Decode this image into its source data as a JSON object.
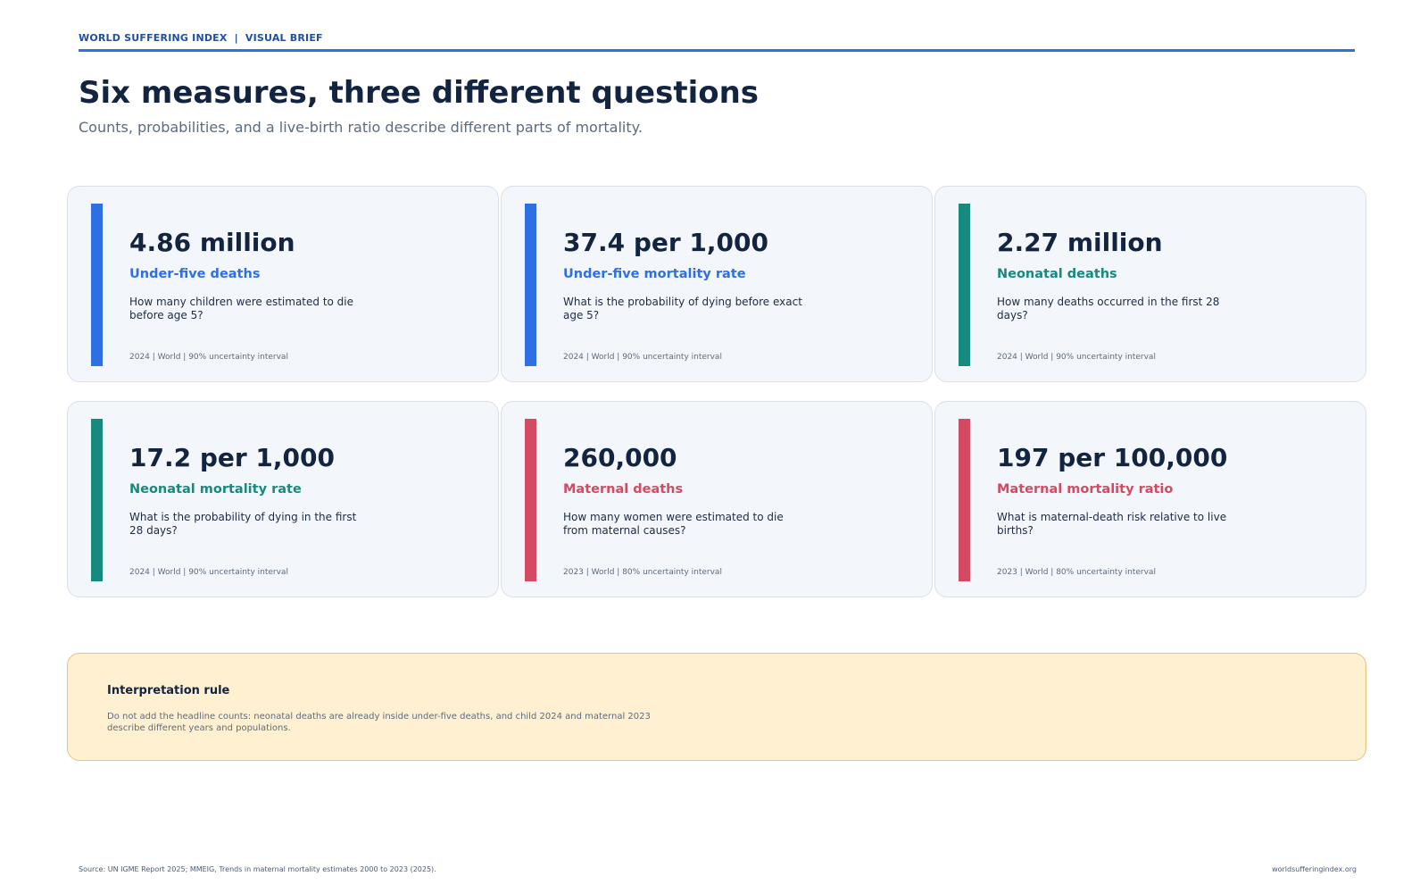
{
  "header": {
    "kicker": "WORLD SUFFERING INDEX  |  VISUAL BRIEF",
    "title": "Six measures, three different questions",
    "subtitle": "Counts, probabilities, and a live-birth ratio describe different parts of mortality."
  },
  "colors": {
    "accent_blue": "#2f6fe4",
    "teal": "#178a80",
    "red": "#d44a63",
    "note_bg": "#fef0d0",
    "note_border": "#e7c374"
  },
  "cards": [
    {
      "value": "4.86 million",
      "label": "Under-five deaths",
      "question": "How many children were estimated to die before age 5?",
      "meta": "2024 | World | 90% uncertainty interval",
      "color": "#2f6fe4"
    },
    {
      "value": "37.4 per 1,000",
      "label": "Under-five mortality rate",
      "question": "What is the probability of dying before exact age 5?",
      "meta": "2024 | World | 90% uncertainty interval",
      "color": "#2f6fe4"
    },
    {
      "value": "2.27 million",
      "label": "Neonatal deaths",
      "question": "How many deaths occurred in the first 28 days?",
      "meta": "2024 | World | 90% uncertainty interval",
      "color": "#178a80"
    },
    {
      "value": "17.2 per 1,000",
      "label": "Neonatal mortality rate",
      "question": "What is the probability of dying in the first 28 days?",
      "meta": "2024 | World | 90% uncertainty interval",
      "color": "#178a80"
    },
    {
      "value": "260,000",
      "label": "Maternal deaths",
      "question": "How many women were estimated to die from maternal causes?",
      "meta": "2023 | World | 80% uncertainty interval",
      "color": "#d44a63"
    },
    {
      "value": "197 per 100,000",
      "label": "Maternal mortality ratio",
      "question": "What is maternal-death risk relative to live births?",
      "meta": "2023 | World | 80% uncertainty interval",
      "color": "#d44a63"
    }
  ],
  "note": {
    "title": "Interpretation rule",
    "body": "Do not add the headline counts: neonatal deaths are already inside under-five deaths, and child 2024 and maternal 2023 describe different years and populations."
  },
  "footer": {
    "source": "Source: UN IGME Report 2025; MMEIG, Trends in maternal mortality estimates 2000 to 2023 (2025).",
    "site": "worldsufferingindex.org"
  }
}
